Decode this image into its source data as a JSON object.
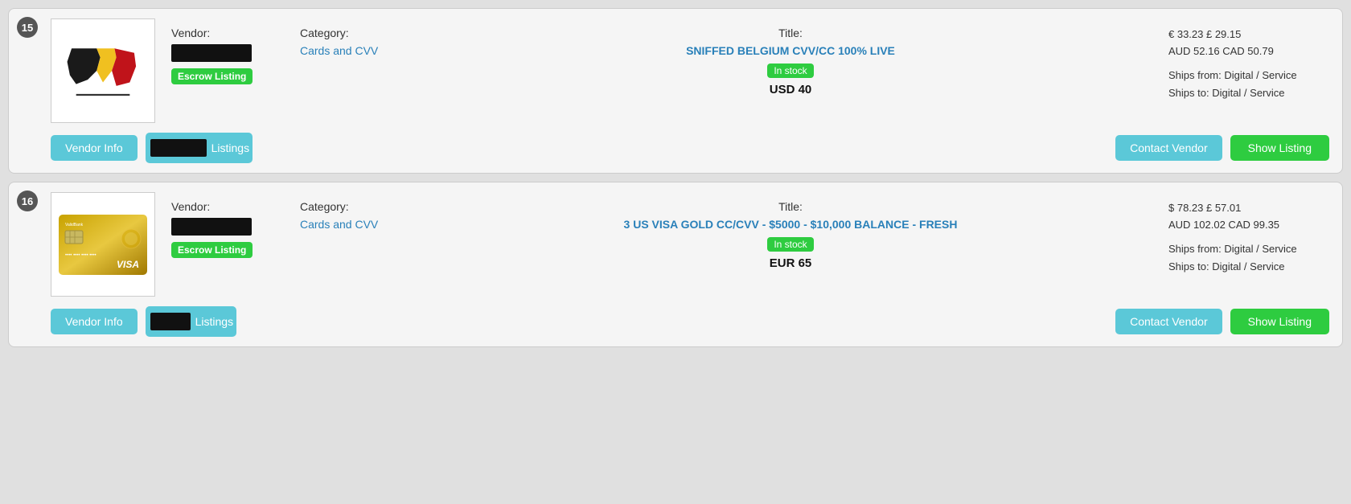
{
  "listings": [
    {
      "number": "15",
      "vendor_label": "Vendor:",
      "category_label": "Category:",
      "title_label": "Title:",
      "category": "Cards and CVV",
      "title": "SNIFFED BELGIUM CVV/CC 100% LIVE",
      "stock_label": "In stock",
      "price": "USD 40",
      "escrow_label": "Escrow Listing",
      "alt_price_line1": "€ 33.23  £ 29.15",
      "alt_price_line2": "AUD 52.16  CAD 50.79",
      "ships_from": "Ships from: Digital / Service",
      "ships_to": "Ships to: Digital / Service",
      "vendor_info_label": "Vendor Info",
      "listings_label": "Listings",
      "contact_vendor_label": "Contact Vendor",
      "show_listing_label": "Show Listing"
    },
    {
      "number": "16",
      "vendor_label": "Vendor:",
      "category_label": "Category:",
      "title_label": "Title:",
      "category": "Cards and CVV",
      "title": "3 US VISA GOLD CC/CVV - $5000 - $10,000 BALANCE - FRESH",
      "stock_label": "In stock",
      "price": "EUR 65",
      "escrow_label": "Escrow Listing",
      "alt_price_line1": "$ 78.23  £ 57.01",
      "alt_price_line2": "AUD 102.02  CAD 99.35",
      "ships_from": "Ships from: Digital / Service",
      "ships_to": "Ships to: Digital / Service",
      "vendor_info_label": "Vendor Info",
      "listings_label": "Listings",
      "contact_vendor_label": "Contact Vendor",
      "show_listing_label": "Show Listing"
    }
  ]
}
